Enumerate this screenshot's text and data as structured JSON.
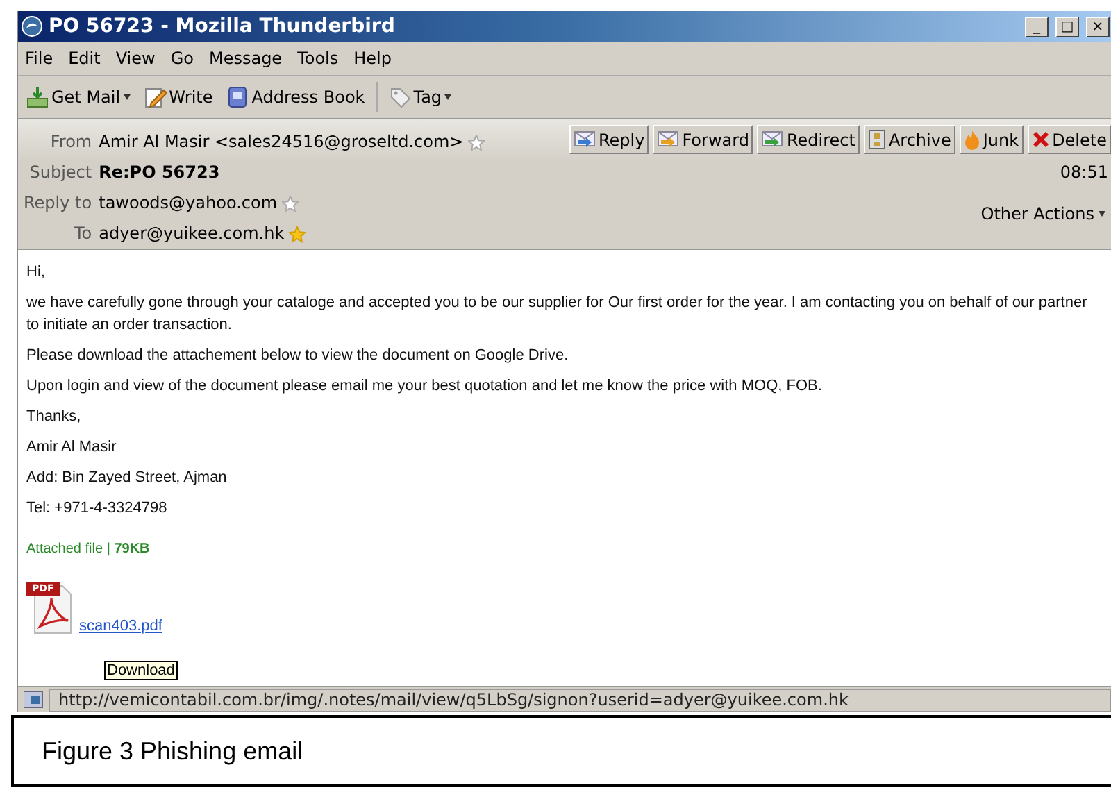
{
  "window": {
    "title": "PO 56723 - Mozilla Thunderbird",
    "controls": [
      "_",
      "□",
      "×"
    ]
  },
  "menu": [
    "File",
    "Edit",
    "View",
    "Go",
    "Message",
    "Tools",
    "Help"
  ],
  "toolbar": [
    {
      "label": "Get Mail",
      "kind": "getmail",
      "dropdown": true
    },
    {
      "label": "Write",
      "kind": "write",
      "dropdown": false
    },
    {
      "label": "Address Book",
      "kind": "book",
      "dropdown": false
    },
    {
      "label": "Tag",
      "kind": "tag",
      "dropdown": true
    }
  ],
  "header": {
    "fields": [
      {
        "label": "From",
        "value": "Amir Al Masir <sales24516@groseltd.com>",
        "bold": false,
        "starred": false
      },
      {
        "label": "Subject",
        "value": "Re:PO 56723",
        "bold": true
      },
      {
        "label": "Reply to",
        "value": "tawoods@yahoo.com",
        "bold": false,
        "starred": false
      },
      {
        "label": "To",
        "value": "adyer@yuikee.com.hk",
        "bold": false,
        "starred": true
      }
    ],
    "actions": [
      {
        "label": "Reply",
        "kind": "reply"
      },
      {
        "label": "Forward",
        "kind": "forward"
      },
      {
        "label": "Redirect",
        "kind": "redirect"
      },
      {
        "label": "Archive",
        "kind": "archive"
      },
      {
        "label": "Junk",
        "kind": "junk"
      },
      {
        "label": "Delete",
        "kind": "delete"
      }
    ],
    "time": "08:51",
    "other_actions": "Other Actions"
  },
  "body": {
    "paragraphs": [
      "Hi,",
      "we have carefully gone through your cataloge and accepted you to be our supplier for Our first order for the year. I am contacting you on behalf of our partner to initiate an order transaction.",
      "Please download the attachement below to view the document on Google Drive.",
      "Upon login and view of the document please email me your best quotation and let me know the price with MOQ, FOB.",
      "Thanks,",
      "Amir Al Masir",
      "Add: Bin Zayed Street, Ajman",
      "Tel: +971-4-3324798"
    ],
    "attachment_note": "Attached file | **79KB**",
    "attachment": {
      "icon_label": "PDF",
      "name": "scan403.pdf"
    },
    "tooltip": "Download"
  },
  "status_bar": "http://vemicontabil.com.br/img/.notes/mail/view/q5LbSg/signon?userid=adyer@yuikee.com.hk",
  "caption": "Figure 3 Phishing email"
}
